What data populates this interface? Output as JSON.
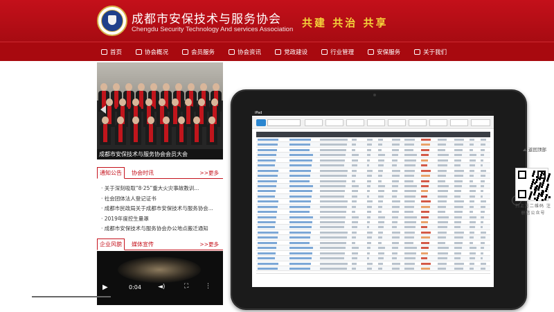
{
  "header": {
    "org_name_cn": "成都市安保技术与服务协会",
    "org_name_en": "Chengdu Security Technology And services Association",
    "slogan": "共建  共治  共享",
    "brand_red": "#c4101a",
    "slogan_yellow": "#f4d23a"
  },
  "nav": {
    "items": [
      {
        "label": "首页",
        "icon": "home-icon"
      },
      {
        "label": "协会概况",
        "icon": "info-icon"
      },
      {
        "label": "会员服务",
        "icon": "members-icon"
      },
      {
        "label": "协会资讯",
        "icon": "news-icon"
      },
      {
        "label": "党政建设",
        "icon": "party-icon"
      },
      {
        "label": "行业管理",
        "icon": "management-icon"
      },
      {
        "label": "安保服务",
        "icon": "service-icon"
      },
      {
        "label": "关于我们",
        "icon": "about-icon"
      }
    ]
  },
  "slider": {
    "caption": "成都市安保技术与服务协会会员大会"
  },
  "notice_panel": {
    "tab_active": "通知公告",
    "tab_inactive": "协会时讯",
    "more": ">>更多",
    "items": [
      "· 关于深刻吸取“8·25”重大火灾事故教训...",
      "· 社会团体法人登记证书",
      "· 成都市民政局关于成都市安保技术与服务协会...",
      "· 2019年度控生量罩",
      "· 成都市安保技术与服务协会办公地点搬迁通知"
    ]
  },
  "media_panel": {
    "tab_active": "企业风貌",
    "tab_inactive": "媒体宣传",
    "more": ">>更多",
    "video_time": "0:04"
  },
  "ipad": {
    "status_carrier": "iPad"
  },
  "float_widget": {
    "back_top": "返回顶部",
    "qr_caption": "扫上方二维码 注册信公众号"
  }
}
